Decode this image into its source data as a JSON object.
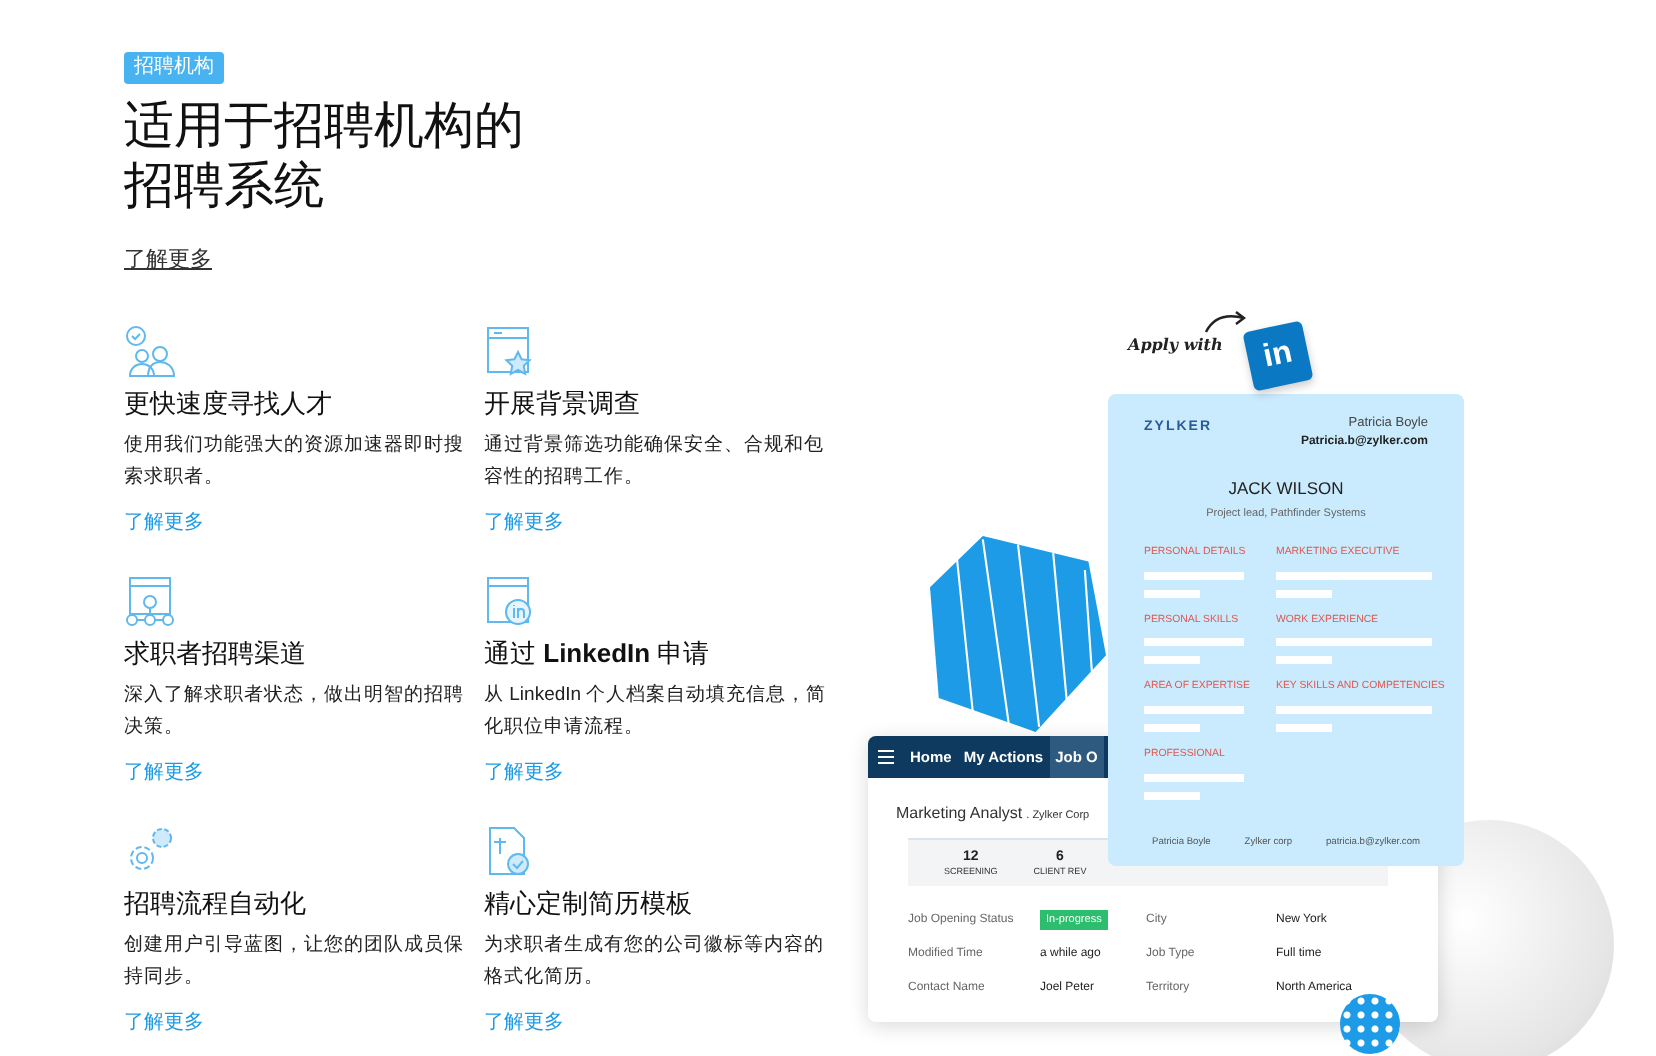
{
  "badge": "招聘机构",
  "title_lines": [
    "适用于招聘机构的",
    "招聘系统"
  ],
  "hero_link": "了解更多",
  "features": [
    {
      "kind": "talent",
      "title": "更快速度寻找人才",
      "description": "使用我们功能强大的资源加速器即时搜索求职者。",
      "link": "了解更多"
    },
    {
      "kind": "background",
      "title": "开展背景调查",
      "description": "通过背景筛选功能确保安全、合规和包容性的招聘工作。",
      "link": "了解更多"
    },
    {
      "kind": "pipeline",
      "title": "求职者招聘渠道",
      "description": "深入了解求职者状态，做出明智的招聘决策。",
      "link": "了解更多"
    },
    {
      "kind": "linkedin",
      "title": "通过 **LinkedIn** 申请",
      "description": "从 LinkedIn 个人档案自动填充信息，简化职位申请流程。",
      "link": "了解更多"
    },
    {
      "kind": "automation",
      "title": "招聘流程自动化",
      "description": "创建用户引导蓝图，让您的团队成员保持同步。",
      "link": "了解更多"
    },
    {
      "kind": "template",
      "title": "精心定制简历模板",
      "description": "为求职者生成有您的公司徽标等内容的格式化简历。",
      "link": "了解更多"
    }
  ],
  "illustration": {
    "apply_label": "Apply with",
    "logo_text": "in",
    "resume": {
      "company": "ZYLKER",
      "contact_name": "Patricia Boyle",
      "contact_email": "Patricia.b@zylker.com",
      "name": "JACK WILSON",
      "role": "Project lead, Pathfinder Systems",
      "sections": [
        {
          "label": "PERSONAL DETAILS"
        },
        {
          "label": "MARKETING EXECUTIVE"
        },
        {
          "label": "PERSONAL SKILLS"
        },
        {
          "label": "WORK EXPERIENCE"
        },
        {
          "label": "AREA OF EXPERTISE"
        },
        {
          "label": "KEY SKILLS AND COMPETENCIES"
        },
        {
          "label": "PROFESSIONAL"
        }
      ],
      "footer": [
        "Patricia Boyle",
        "Zylker corp",
        "patricia.b@zylker.com"
      ]
    },
    "app": {
      "tabs": [
        {
          "label": "Home",
          "selected": false
        },
        {
          "label": "My Actions",
          "selected": false
        },
        {
          "label": "Job O",
          "selected": true
        }
      ],
      "job_title": "Marketing Analyst",
      "company": ". Zylker Corp",
      "stats": [
        {
          "value": "12",
          "label": "SCREENING"
        },
        {
          "value": "6",
          "label": "CLIENT REV"
        }
      ],
      "fields": [
        {
          "label": "Job Opening Status",
          "value": "In-progress",
          "kind": "status"
        },
        {
          "label": "City",
          "value": "New York",
          "kind": "text"
        },
        {
          "label": "Modified Time",
          "value": "a while ago",
          "kind": "text"
        },
        {
          "label": "Job Type",
          "value": "Full time",
          "kind": "text"
        },
        {
          "label": "Contact Name",
          "value": "Joel Peter",
          "kind": "text"
        },
        {
          "label": "Territory",
          "value": "North America",
          "kind": "text"
        }
      ]
    }
  }
}
